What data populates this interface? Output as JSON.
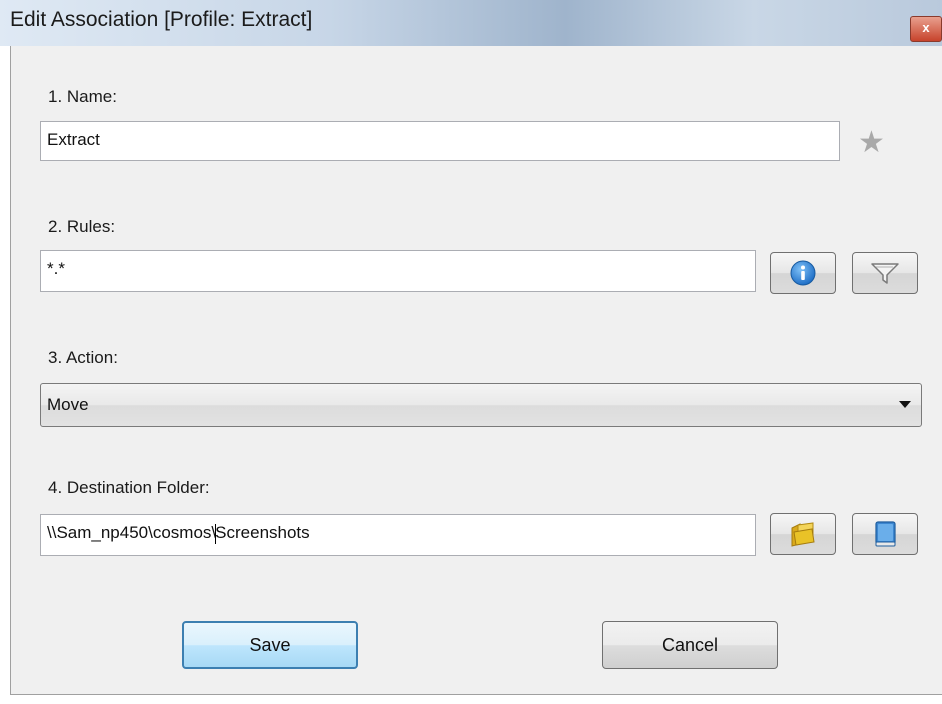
{
  "window": {
    "title": "Edit Association [Profile: Extract]",
    "close_glyph": "x"
  },
  "form": {
    "name_label": "1. Name:",
    "name_value": "Extract",
    "rules_label": "2. Rules:",
    "rules_value": "*.*",
    "action_label": "3. Action:",
    "action_selected": "Move",
    "destination_label": "4. Destination Folder:",
    "destination_value_prefix": "\\\\Sam_np450\\cosmos\\",
    "destination_value_suffix": "Screenshots"
  },
  "buttons": {
    "save": "Save",
    "cancel": "Cancel"
  },
  "icons": {
    "favorite": "star-icon",
    "rules_info": "info-icon",
    "rules_filter": "filter-icon",
    "browse_folder": "folder-icon",
    "library": "book-icon"
  },
  "colors": {
    "info_blue": "#1f6fc7",
    "folder_yellow": "#e9c227",
    "book_blue": "#3c86d0",
    "save_border": "#3c7fb1"
  }
}
